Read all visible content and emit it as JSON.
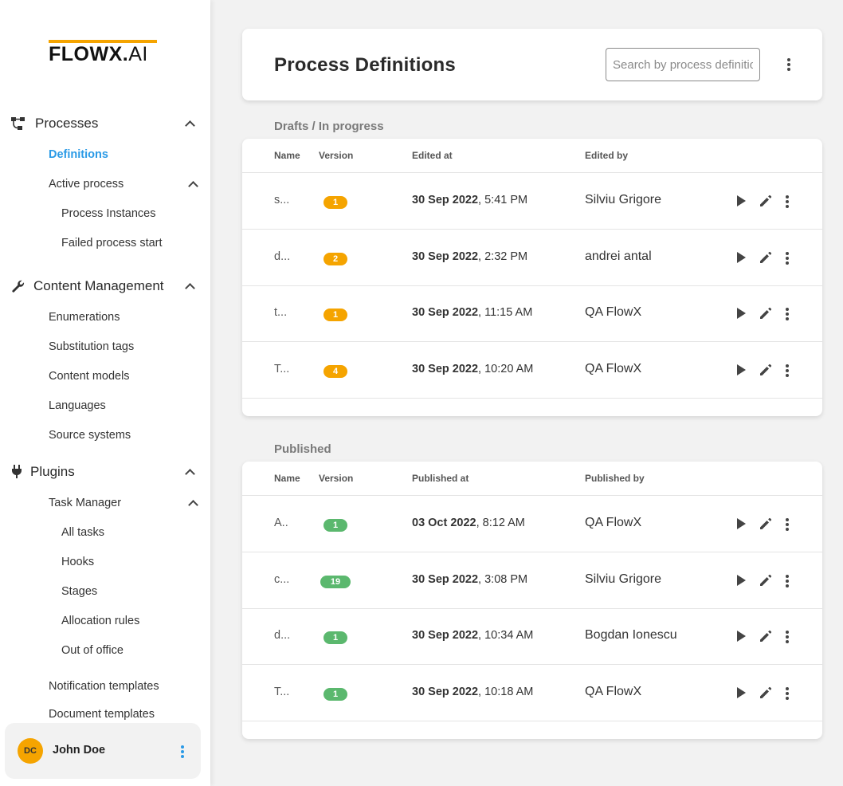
{
  "logo": {
    "main": "FLOWX",
    "dot": ".",
    "ai": "AI"
  },
  "sidebar": {
    "processes": {
      "label": "Processes",
      "definitions": "Definitions",
      "active_process": "Active process",
      "process_instances": "Process Instances",
      "failed_process_start": "Failed process start"
    },
    "content_management": {
      "label": "Content Management",
      "items": [
        "Enumerations",
        "Substitution tags",
        "Content models",
        "Languages",
        "Source systems"
      ]
    },
    "plugins": {
      "label": "Plugins",
      "task_manager": "Task Manager",
      "task_items": [
        "All tasks",
        "Hooks",
        "Stages",
        "Allocation rules",
        "Out of office"
      ],
      "notification_templates": "Notification templates",
      "document_templates_partial": "Document templates"
    },
    "user": {
      "initials": "DC",
      "name": "John Doe"
    }
  },
  "header": {
    "title": "Process Definitions",
    "search_placeholder": "Search by process definition"
  },
  "drafts": {
    "label": "Drafts / In progress",
    "columns": {
      "name": "Name",
      "version": "Version",
      "date": "Edited at",
      "by": "Edited by"
    },
    "rows": [
      {
        "name": "s...",
        "version": "1",
        "date_bold": "30 Sep 2022",
        "time": ", 5:41 PM",
        "by": "Silviu Grigore"
      },
      {
        "name": "d...",
        "version": "2",
        "date_bold": "30 Sep 2022",
        "time": ", 2:32 PM",
        "by": "andrei antal"
      },
      {
        "name": "t...",
        "version": "1",
        "date_bold": "30 Sep 2022",
        "time": ", 11:15 AM",
        "by": "QA FlowX"
      },
      {
        "name": "T...",
        "version": "4",
        "date_bold": "30 Sep 2022",
        "time": ", 10:20 AM",
        "by": "QA FlowX"
      }
    ]
  },
  "published": {
    "label": "Published",
    "columns": {
      "name": "Name",
      "version": "Version",
      "date": "Published at",
      "by": "Published by"
    },
    "rows": [
      {
        "name": "A..",
        "version": "1",
        "date_bold": "03 Oct 2022",
        "time": ", 8:12 AM",
        "by": "QA FlowX"
      },
      {
        "name": "c...",
        "version": "19",
        "date_bold": "30 Sep 2022",
        "time": ", 3:08 PM",
        "by": "Silviu Grigore"
      },
      {
        "name": "d...",
        "version": "1",
        "date_bold": "30 Sep 2022",
        "time": ", 10:34 AM",
        "by": "Bogdan Ionescu"
      },
      {
        "name": "T...",
        "version": "1",
        "date_bold": "30 Sep 2022",
        "time": ", 10:18 AM",
        "by": "QA FlowX"
      }
    ]
  },
  "colors": {
    "accent": "#2a9ae6",
    "brand": "#f5a400",
    "draft_badge": "#f5a400",
    "published_badge": "#5bb86e"
  }
}
